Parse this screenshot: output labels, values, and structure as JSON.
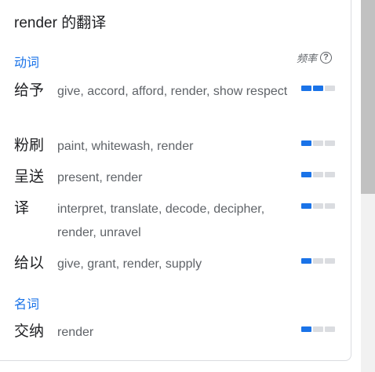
{
  "title": "render 的翻译",
  "frequency_label": "频率",
  "help_icon": "?",
  "sections": [
    {
      "pos": "动词",
      "entries": [
        {
          "term": "给予",
          "translations": "give, accord, afford, render, show respect",
          "frequency": 2
        },
        {
          "term": "粉刷",
          "translations": "paint, whitewash, render",
          "frequency": 1
        },
        {
          "term": "呈送",
          "translations": "present, render",
          "frequency": 1
        },
        {
          "term": "译",
          "translations": "interpret, translate, decode, decipher, render, unravel",
          "frequency": 1
        },
        {
          "term": "给以",
          "translations": "give, grant, render, supply",
          "frequency": 1
        }
      ]
    },
    {
      "pos": "名词",
      "entries": [
        {
          "term": "交纳",
          "translations": "render",
          "frequency": 1
        }
      ]
    }
  ],
  "frequency_max": 3,
  "colors": {
    "accent": "#1a73e8",
    "bar_off": "#dadce0"
  }
}
